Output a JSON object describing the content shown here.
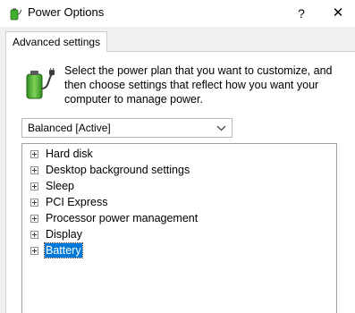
{
  "window": {
    "title": "Power Options",
    "help_glyph": "?",
    "close_glyph": "✕"
  },
  "tabs": [
    {
      "label": "Advanced settings",
      "selected": true
    }
  ],
  "description": "Select the power plan that you want to customize, and then choose settings that reflect how you want your computer to manage power.",
  "plan_select": {
    "value": "Balanced [Active]"
  },
  "tree": {
    "items": [
      {
        "label": "Hard disk",
        "expanded": false,
        "selected": false
      },
      {
        "label": "Desktop background settings",
        "expanded": false,
        "selected": false
      },
      {
        "label": "Sleep",
        "expanded": false,
        "selected": false
      },
      {
        "label": "PCI Express",
        "expanded": false,
        "selected": false
      },
      {
        "label": "Processor power management",
        "expanded": false,
        "selected": false
      },
      {
        "label": "Display",
        "expanded": false,
        "selected": false
      },
      {
        "label": "Battery",
        "expanded": false,
        "selected": true
      }
    ]
  },
  "icons": {
    "app": "power-options-icon",
    "battery": "battery-plug-icon",
    "dropdown": "chevron-down-icon",
    "expander": "plus-box-icon"
  },
  "colors": {
    "selection": "#0078d7",
    "battery_green": "#3fae2a"
  }
}
